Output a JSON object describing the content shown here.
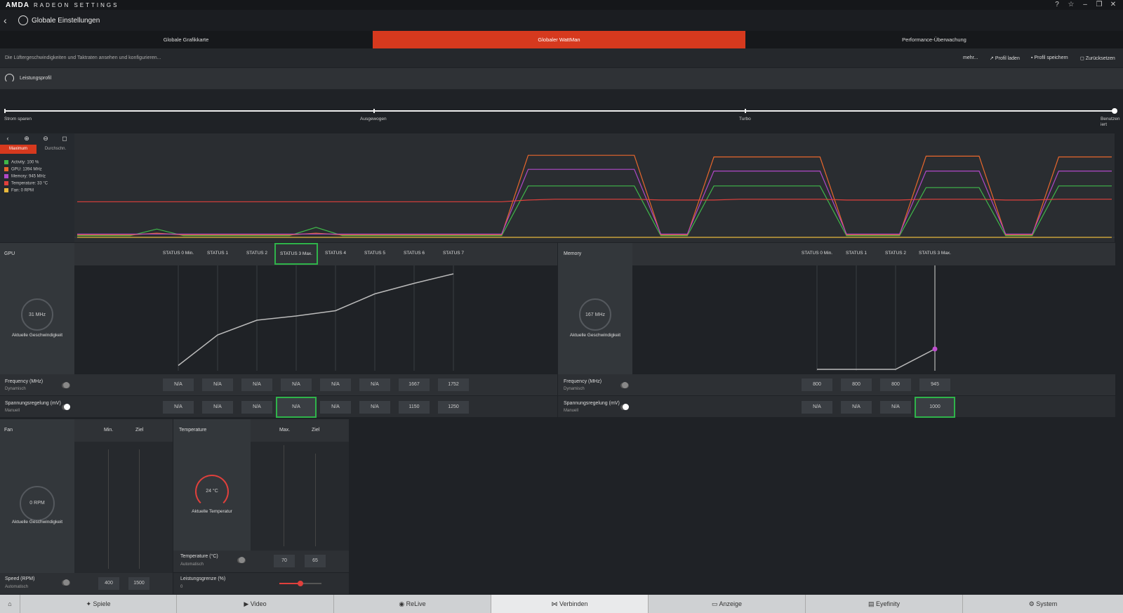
{
  "app": {
    "brand": "AMDA",
    "brand_sub": "RADEON SETTINGS",
    "page_title": "Globale Einstellungen"
  },
  "tabs": [
    {
      "label": "Globale Grafikkarte"
    },
    {
      "label": "Globaler WattMan",
      "active": true
    },
    {
      "label": "Performance-Überwachung"
    }
  ],
  "description": "Die Lüftergeschwindigkeiten und Taktraten ansehen und konfigurieren...",
  "actions": {
    "more": "mehr...",
    "load": "Profil laden",
    "save": "Profil speichern",
    "reset": "Zurücksetzen"
  },
  "profile": {
    "label": "Leistungsprofil",
    "stops": [
      "Strom sparen",
      "Ausgewogen",
      "Turbo",
      "Benutzerdefiniert"
    ],
    "last_stop_lines": [
      "Benutzen",
      "iert"
    ],
    "selected": "Benutzerdefiniert"
  },
  "chart_controls": {
    "tab_max": "Maximum",
    "tab_avg": "Durchschn."
  },
  "legend": [
    {
      "label": "Activity: 100 %",
      "color": "#3fb84a"
    },
    {
      "label": "GPU: 1394 MHz",
      "color": "#e8672c"
    },
    {
      "label": "Memory: 945 MHz",
      "color": "#b048c8"
    },
    {
      "label": "Temperature: 33 °C",
      "color": "#e0403c"
    },
    {
      "label": "Fan: 0 RPM",
      "color": "#e8b83c"
    }
  ],
  "chart_data": {
    "type": "line",
    "x": [
      0,
      1,
      2,
      3,
      4,
      5,
      6,
      7,
      8,
      9,
      10,
      11,
      12,
      13,
      14,
      15,
      16,
      17,
      18,
      19,
      20,
      21,
      22,
      23,
      24,
      25,
      26,
      27,
      28,
      29,
      30,
      31,
      32,
      33,
      34,
      35,
      36,
      37,
      38,
      39
    ],
    "series": [
      {
        "name": "Activity",
        "color": "#3fb84a",
        "values": [
          2,
          2,
          2,
          10,
          2,
          2,
          2,
          2,
          2,
          12,
          2,
          2,
          2,
          2,
          2,
          2,
          2,
          62,
          62,
          62,
          62,
          62,
          2,
          2,
          62,
          62,
          62,
          62,
          62,
          2,
          2,
          2,
          60,
          60,
          60,
          2,
          2,
          62,
          62,
          62
        ]
      },
      {
        "name": "GPU",
        "color": "#e8672c",
        "values": [
          3,
          3,
          3,
          5,
          3,
          3,
          3,
          3,
          3,
          5,
          3,
          3,
          3,
          3,
          3,
          3,
          3,
          99,
          99,
          99,
          99,
          99,
          3,
          3,
          97,
          97,
          97,
          97,
          97,
          3,
          3,
          3,
          98,
          98,
          98,
          3,
          3,
          97,
          97,
          97
        ]
      },
      {
        "name": "Memory",
        "color": "#b048c8",
        "values": [
          4,
          4,
          4,
          4,
          4,
          4,
          4,
          4,
          4,
          4,
          4,
          4,
          4,
          4,
          4,
          4,
          4,
          82,
          82,
          82,
          82,
          82,
          4,
          4,
          80,
          80,
          80,
          80,
          80,
          4,
          4,
          4,
          80,
          80,
          80,
          4,
          4,
          80,
          80,
          80
        ]
      },
      {
        "name": "Temperature",
        "color": "#e0403c",
        "values": [
          43,
          43,
          43,
          43,
          43,
          43,
          43,
          43,
          43,
          43,
          43,
          43,
          43,
          43,
          43,
          43,
          43,
          45,
          46,
          46,
          46,
          46,
          45,
          45,
          45,
          46,
          46,
          46,
          46,
          45,
          45,
          45,
          46,
          46,
          46,
          45,
          45,
          46,
          46,
          46
        ]
      },
      {
        "name": "Fan",
        "color": "#e8b83c",
        "values": [
          0,
          0,
          0,
          0,
          0,
          0,
          0,
          0,
          0,
          0,
          0,
          0,
          0,
          0,
          0,
          0,
          0,
          0,
          0,
          0,
          0,
          0,
          0,
          0,
          0,
          0,
          0,
          0,
          0,
          0,
          0,
          0,
          0,
          0,
          0,
          0,
          0,
          0,
          0,
          0
        ]
      }
    ],
    "ylim": [
      0,
      100
    ]
  },
  "gpu": {
    "title": "GPU",
    "states": [
      "STATUS 0 Min.",
      "STATUS 1",
      "STATUS 2",
      "STATUS 3 Max.",
      "STATUS 4",
      "STATUS 5",
      "STATUS 6",
      "STATUS 7"
    ],
    "gauge_value": "31 MHz",
    "gauge_caption": "Aktuelle Geschwindigkeit",
    "freq_title": "Frequency (MHz)",
    "freq_sub": "Dynamisch",
    "freq_values": [
      "N/A",
      "N/A",
      "N/A",
      "N/A",
      "N/A",
      "N/A",
      "1667",
      "1752"
    ],
    "volt_title": "Spannungsregelung (mV)",
    "volt_sub": "Manuell",
    "volt_values": [
      "N/A",
      "N/A",
      "N/A",
      "N/A",
      "N/A",
      "N/A",
      "1150",
      "1250"
    ],
    "curve": [
      0.05,
      0.34,
      0.48,
      0.52,
      0.57,
      0.73,
      0.83,
      0.92
    ]
  },
  "memory": {
    "title": "Memory",
    "states": [
      "STATUS 0 Min.",
      "STATUS 1",
      "STATUS 2",
      "STATUS 3 Max."
    ],
    "gauge_value": "167 MHz",
    "gauge_caption": "Aktuelle Geschwindigkeit",
    "freq_title": "Frequency (MHz)",
    "freq_sub": "Dynamisch",
    "freq_values": [
      "800",
      "800",
      "800",
      "945"
    ],
    "volt_title": "Spannungsregelung (mV)",
    "volt_sub": "Manuell",
    "volt_values": [
      "N/A",
      "N/A",
      "N/A",
      "1000"
    ]
  },
  "fan": {
    "title": "Fan",
    "min_label": "Min.",
    "target_label": "Ziel",
    "gauge_value": "0 RPM",
    "gauge_caption": "Aktuelle Geschwindigkeit",
    "speed_title": "Speed (RPM)",
    "speed_sub": "Automatisch",
    "speed_min": "400",
    "speed_target": "1500"
  },
  "temperature": {
    "title": "Temperature",
    "max_label": "Max.",
    "target_label": "Ziel",
    "gauge_value": "24 °C",
    "gauge_caption": "Aktuelle Temperatur",
    "temp_title": "Temperature (°C)",
    "temp_sub": "Automatisch",
    "temp_max": "70",
    "temp_target": "65",
    "power_title": "Leistungsgrenze (%)",
    "power_value": "0"
  },
  "bottom_nav": [
    {
      "label": "Spiele",
      "icon": "gamepad-icon"
    },
    {
      "label": "Video",
      "icon": "play-icon"
    },
    {
      "label": "ReLive",
      "icon": "relive-icon"
    },
    {
      "label": "Verbinden",
      "icon": "share-icon",
      "active": true
    },
    {
      "label": "Anzeige",
      "icon": "monitor-icon"
    },
    {
      "label": "Eyefinity",
      "icon": "eyefinity-icon"
    },
    {
      "label": "System",
      "icon": "system-icon"
    }
  ]
}
